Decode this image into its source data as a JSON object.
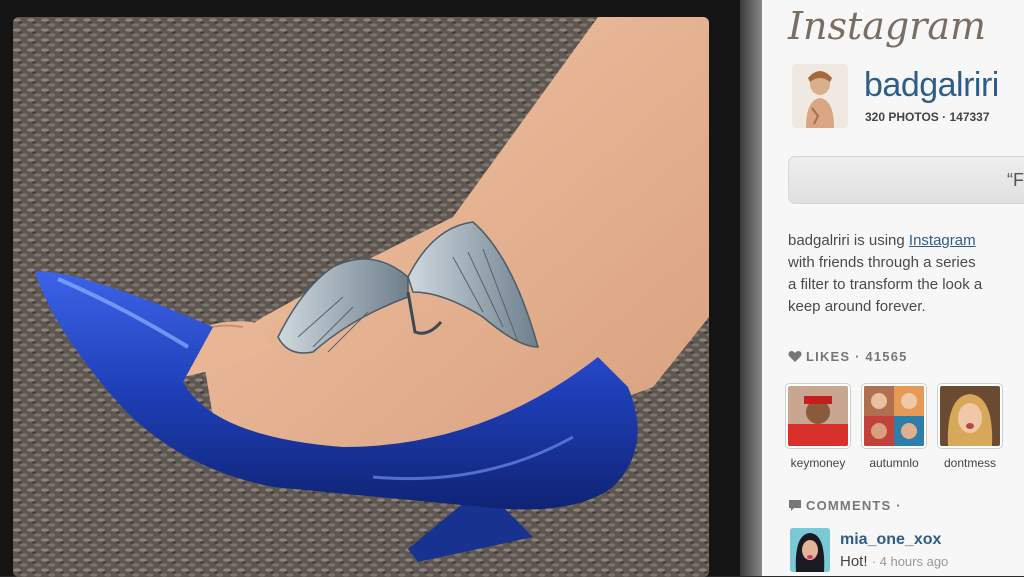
{
  "app": {
    "logo_text": "Instagram",
    "brand_color": "#2e5e87"
  },
  "photo": {
    "subject": "foot-with-wing-tattoo-in-blue-heel",
    "shoe_color": "#1f3fb8"
  },
  "profile": {
    "username": "badgalriri",
    "stats": "320 PHOTOS · 147337",
    "follow_label": "“F"
  },
  "description": {
    "line1_prefix": "badgalriri is using ",
    "line1_link": "Instagram",
    "line2": "with friends through a series",
    "line3": "a filter to transform the look a",
    "line4": "keep around forever."
  },
  "likes": {
    "header": "LIKES · 41565",
    "users": [
      {
        "name": "keymoney"
      },
      {
        "name": "autumnlo"
      },
      {
        "name": "dontmess"
      }
    ]
  },
  "comments": {
    "header": "COMMENTS ·",
    "items": [
      {
        "user": "mia_one_xox",
        "text": "Hot!",
        "time": "· 4 hours ago"
      }
    ]
  }
}
